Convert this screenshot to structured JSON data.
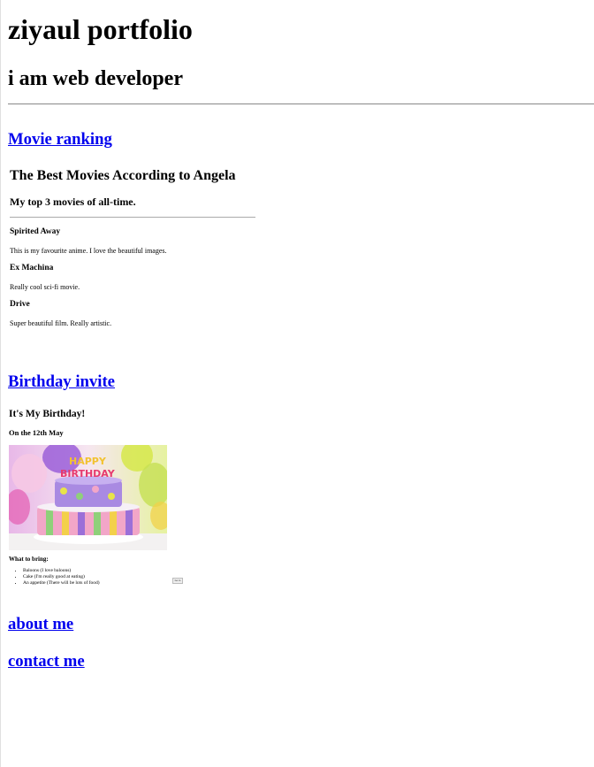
{
  "header": {
    "title": "ziyaul portfolio",
    "subtitle": "i am web developer"
  },
  "sections": {
    "movie_link": "Movie ranking",
    "birthday_link": "Birthday invite",
    "about_link": "about me",
    "contact_link": "contact me"
  },
  "movies_preview": {
    "title": "The Best Movies According to Angela",
    "subtitle": "My top 3 movies of all-time.",
    "items": [
      {
        "name": "Spirited Away",
        "desc": "This is my favourite anime. I love the beautiful images."
      },
      {
        "name": "Ex Machina",
        "desc": "Really cool sci-fi movie."
      },
      {
        "name": "Drive",
        "desc": "Super beautiful film. Really artistic."
      }
    ]
  },
  "birthday_preview": {
    "title": "It's My Birthday!",
    "date": "On the 12th May",
    "cake_text": "HAPPY BIRTHDAY",
    "bring_label": "What to bring:",
    "items": [
      "Baloons (I love baloons)",
      "Cake (I'm really good at eating)",
      "An appetite (There will be lots of food)"
    ],
    "button": "Go to"
  },
  "colors": {
    "link": "#0000ee",
    "divider": "#888888"
  }
}
